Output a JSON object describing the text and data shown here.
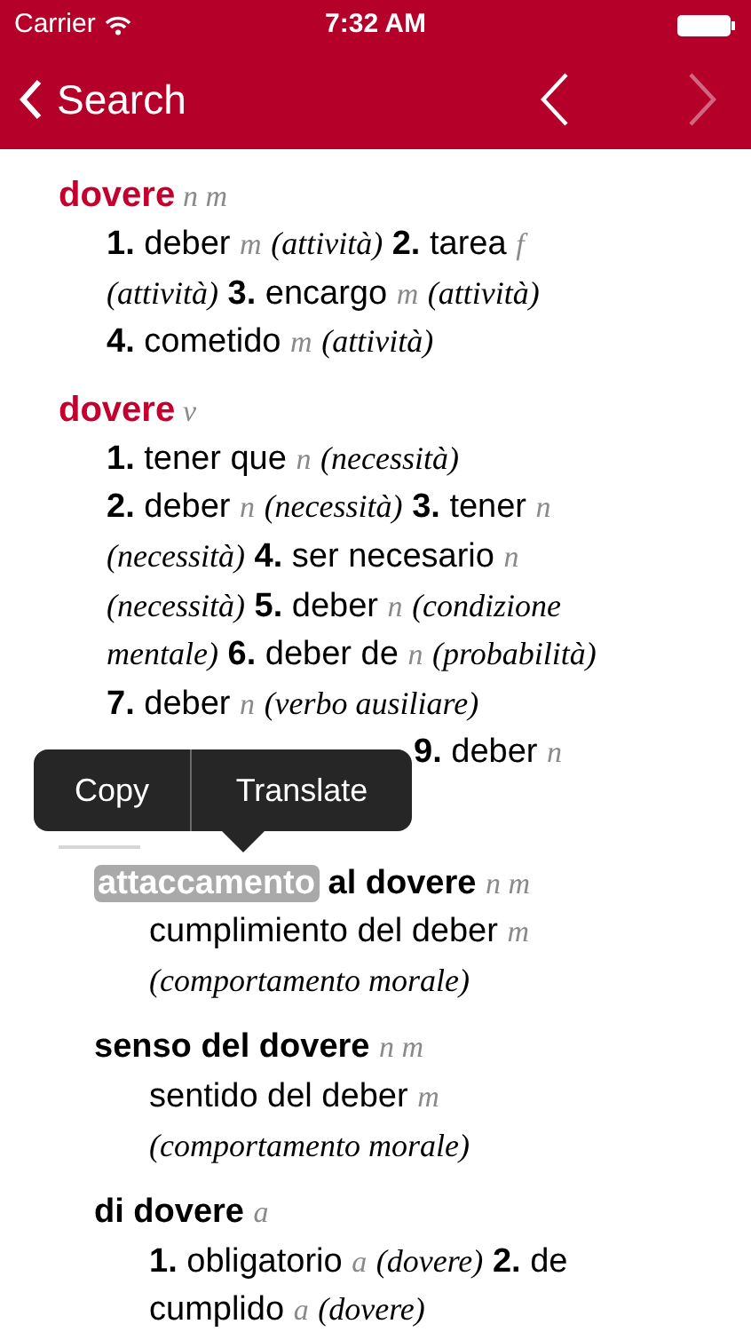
{
  "status_bar": {
    "carrier": "Carrier",
    "time": "7:32 AM"
  },
  "nav_bar": {
    "back_label": "Search",
    "previous": {
      "disabled": false
    },
    "next": {
      "disabled": true
    }
  },
  "entries": [
    {
      "headword": "dovere",
      "grammar": "n m",
      "lines": [
        [
          {
            "kind": "num",
            "text": "1."
          },
          {
            "kind": "word",
            "text": "deber"
          },
          {
            "kind": "gram",
            "text": "m"
          },
          {
            "kind": "ctx",
            "text": "(attività)"
          },
          {
            "kind": "num",
            "text": "2."
          },
          {
            "kind": "word",
            "text": "tarea"
          },
          {
            "kind": "gram",
            "text": "f"
          }
        ],
        [
          {
            "kind": "ctx",
            "text": "(attività)"
          },
          {
            "kind": "num",
            "text": "3."
          },
          {
            "kind": "word",
            "text": "encargo"
          },
          {
            "kind": "gram",
            "text": "m"
          },
          {
            "kind": "ctx",
            "text": "(attività)"
          }
        ],
        [
          {
            "kind": "num",
            "text": "4."
          },
          {
            "kind": "word",
            "text": "cometido"
          },
          {
            "kind": "gram",
            "text": "m"
          },
          {
            "kind": "ctx",
            "text": "(attività)"
          }
        ]
      ]
    },
    {
      "headword": "dovere",
      "grammar": "v",
      "lines": [
        [
          {
            "kind": "num",
            "text": "1."
          },
          {
            "kind": "word",
            "text": "tener que"
          },
          {
            "kind": "gram",
            "text": "n"
          },
          {
            "kind": "ctx",
            "text": "(necessità)"
          }
        ],
        [
          {
            "kind": "num",
            "text": "2."
          },
          {
            "kind": "word",
            "text": "deber"
          },
          {
            "kind": "gram",
            "text": "n"
          },
          {
            "kind": "ctx",
            "text": "(necessità)"
          },
          {
            "kind": "num",
            "text": "3."
          },
          {
            "kind": "word",
            "text": "tener"
          },
          {
            "kind": "gram",
            "text": "n"
          }
        ],
        [
          {
            "kind": "ctx",
            "text": "(necessità)"
          },
          {
            "kind": "num",
            "text": "4."
          },
          {
            "kind": "word",
            "text": "ser necesario"
          },
          {
            "kind": "gram",
            "text": "n"
          }
        ],
        [
          {
            "kind": "ctx",
            "text": "(necessità)"
          },
          {
            "kind": "num",
            "text": "5."
          },
          {
            "kind": "word",
            "text": "deber"
          },
          {
            "kind": "gram",
            "text": "n"
          },
          {
            "kind": "ctx",
            "text": "(condizione"
          }
        ],
        [
          {
            "kind": "ctx",
            "text": "mentale)"
          },
          {
            "kind": "num",
            "text": "6."
          },
          {
            "kind": "word",
            "text": "deber de"
          },
          {
            "kind": "gram",
            "text": "n"
          },
          {
            "kind": "ctx",
            "text": "(probabilità)"
          }
        ],
        [
          {
            "kind": "num",
            "text": "7."
          },
          {
            "kind": "word",
            "text": "deber"
          },
          {
            "kind": "gram",
            "text": "n"
          },
          {
            "kind": "ctx",
            "text": "(verbo ausiliare)"
          }
        ]
      ],
      "covered_line": [
        {
          "kind": "num",
          "text": "9."
        },
        {
          "kind": "word",
          "text": "deber"
        },
        {
          "kind": "gram",
          "text": "n"
        }
      ]
    }
  ],
  "popup_menu": {
    "items": [
      "Copy",
      "Translate"
    ]
  },
  "phrases": [
    {
      "head": [
        {
          "kind": "selected",
          "text": "attaccamento"
        },
        {
          "kind": "head",
          "text": "al dovere"
        },
        {
          "kind": "gram",
          "text": "n m"
        }
      ],
      "lines": [
        [
          {
            "kind": "word",
            "text": "cumplimiento del deber"
          },
          {
            "kind": "gram",
            "text": "m"
          }
        ],
        [
          {
            "kind": "ctx",
            "text": "(comportamento morale)"
          }
        ]
      ]
    },
    {
      "head": [
        {
          "kind": "head",
          "text": "senso del dovere"
        },
        {
          "kind": "gram",
          "text": "n m"
        }
      ],
      "lines": [
        [
          {
            "kind": "word",
            "text": "sentido del deber"
          },
          {
            "kind": "gram",
            "text": "m"
          }
        ],
        [
          {
            "kind": "ctx",
            "text": "(comportamento morale)"
          }
        ]
      ]
    },
    {
      "head": [
        {
          "kind": "head",
          "text": "di dovere"
        },
        {
          "kind": "gram",
          "text": "a"
        }
      ],
      "lines": [
        [
          {
            "kind": "num",
            "text": "1."
          },
          {
            "kind": "word",
            "text": "obligatorio"
          },
          {
            "kind": "gram",
            "text": "a"
          },
          {
            "kind": "ctx",
            "text": "(dovere)"
          },
          {
            "kind": "num",
            "text": "2."
          },
          {
            "kind": "word",
            "text": "de"
          }
        ],
        [
          {
            "kind": "word",
            "text": "cumplido"
          },
          {
            "kind": "gram",
            "text": "a"
          },
          {
            "kind": "ctx",
            "text": "(dovere)"
          }
        ]
      ]
    }
  ]
}
